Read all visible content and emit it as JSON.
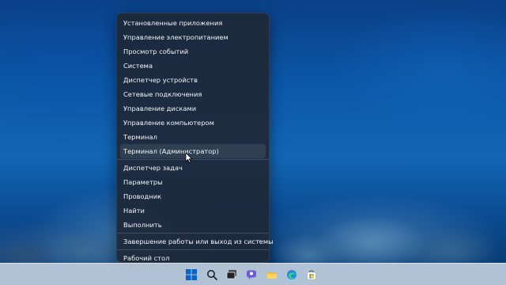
{
  "menu": {
    "items": [
      {
        "label": "Установленные приложения"
      },
      {
        "label": "Управление электропитанием"
      },
      {
        "label": "Просмотр событий"
      },
      {
        "label": "Система"
      },
      {
        "label": "Диспетчер устройств"
      },
      {
        "label": "Сетевые подключения"
      },
      {
        "label": "Управление дисками"
      },
      {
        "label": "Управление компьютером"
      },
      {
        "label": "Терминал"
      },
      {
        "label": "Терминал (Администратор)"
      },
      {
        "label": "Диспетчер задач"
      },
      {
        "label": "Параметры"
      },
      {
        "label": "Проводник"
      },
      {
        "label": "Найти"
      },
      {
        "label": "Выполнить"
      },
      {
        "label": "Завершение работы или выход из системы",
        "chevron": "›"
      },
      {
        "label": "Рабочий стол"
      }
    ]
  },
  "taskbar": {
    "icons": [
      "windows-start-icon",
      "search-icon",
      "task-view-icon",
      "chat-icon",
      "file-explorer-icon",
      "edge-browser-icon",
      "microsoft-store-icon"
    ]
  },
  "colors": {
    "menu_bg": "#1e2838",
    "accent": "#0a63c9",
    "taskbar_bg": "#d6e2ee"
  }
}
